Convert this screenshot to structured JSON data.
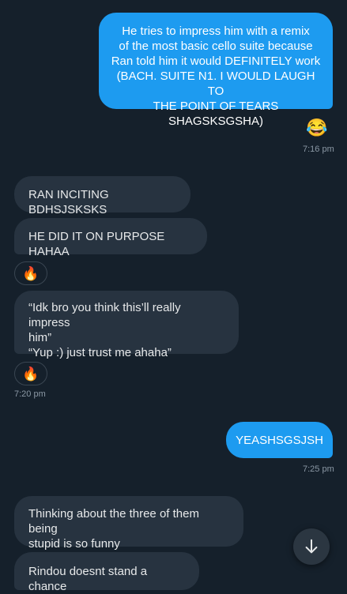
{
  "messages": {
    "m1": {
      "lines": [
        "He tries to impress him with a remix",
        "of the most basic cello suite because",
        "Ran told him it would DEFINITELY work",
        "(BACH. SUITE N1. I WOULD LAUGH TO",
        "THE POINT OF TEARS SHAGSKSGSHA)"
      ]
    },
    "m1_reaction": "😂",
    "time1": "7:16 pm",
    "m2": "RAN INCITING BDHSJSKSKS",
    "m3": "HE DID IT ON PURPOSE HAHAA",
    "m3_reaction": "🔥",
    "m4": {
      "lines": [
        "“Idk bro you think this’ll really impress",
        "him”",
        "“Yup :) just trust me ahaha”"
      ]
    },
    "m4_reaction": "🔥",
    "time2": "7:20 pm",
    "m5": "YEASHSGSJSH",
    "time3": "7:25 pm",
    "m6": {
      "lines": [
        "Thinking about the three of them being",
        "stupid is so funny"
      ]
    },
    "m7": "Rindou doesnt stand a chance",
    "colors": {
      "background": "#15202b",
      "outgoing_bubble": "#1d9bf0",
      "incoming_bubble": "#273340",
      "timestamp": "#8b98a5"
    },
    "icons": {
      "scroll_down": "arrow-down-icon"
    }
  }
}
